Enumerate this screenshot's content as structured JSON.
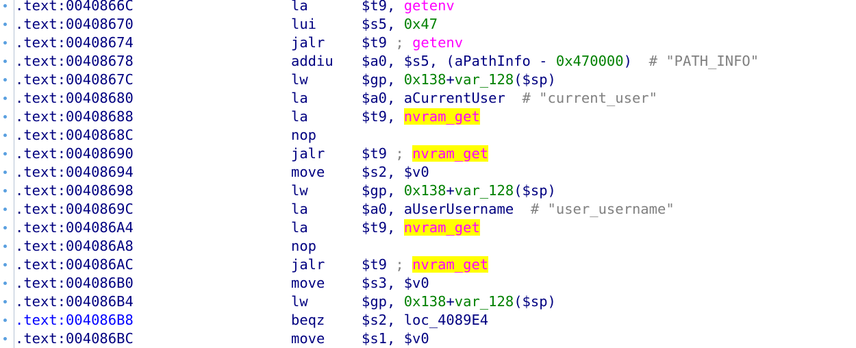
{
  "colors": {
    "background": "#ffffff",
    "address": "#000080",
    "active_address": "#0000ff",
    "mnemonic": "#000080",
    "register": "#000080",
    "import_name": "#ff00ff",
    "number": "#008000",
    "comment": "#808080",
    "highlight": "#ffff00",
    "gutter_dot": "#5aa0e0"
  },
  "listing": {
    "rows": [
      {
        "address": ".text:0040866C",
        "mnemonic": "la",
        "active": false,
        "operands": [
          {
            "t": "$t9, ",
            "c": "reg"
          },
          {
            "t": "getenv",
            "c": "imp"
          }
        ]
      },
      {
        "address": ".text:00408670",
        "mnemonic": "lui",
        "active": false,
        "operands": [
          {
            "t": "$s5, ",
            "c": "reg"
          },
          {
            "t": "0x47",
            "c": "num"
          }
        ]
      },
      {
        "address": ".text:00408674",
        "mnemonic": "jalr",
        "active": false,
        "operands": [
          {
            "t": "$t9 ",
            "c": "reg"
          },
          {
            "t": "; ",
            "c": "cmt"
          },
          {
            "t": "getenv",
            "c": "imp"
          }
        ]
      },
      {
        "address": ".text:00408678",
        "mnemonic": "addiu",
        "active": false,
        "operands": [
          {
            "t": "$a0, $s5, (aPathInfo - ",
            "c": "reg"
          },
          {
            "t": "0x470000",
            "c": "num"
          },
          {
            "t": ")  ",
            "c": "reg"
          },
          {
            "t": "# \"PATH_INFO\"",
            "c": "cmt"
          }
        ]
      },
      {
        "address": ".text:0040867C",
        "mnemonic": "lw",
        "active": false,
        "operands": [
          {
            "t": "$gp, ",
            "c": "reg"
          },
          {
            "t": "0x138",
            "c": "num"
          },
          {
            "t": "+",
            "c": "reg"
          },
          {
            "t": "var_128",
            "c": "data"
          },
          {
            "t": "($sp)",
            "c": "reg"
          }
        ]
      },
      {
        "address": ".text:00408680",
        "mnemonic": "la",
        "active": false,
        "operands": [
          {
            "t": "$a0, aCurrentUser  ",
            "c": "reg"
          },
          {
            "t": "# \"current_user\"",
            "c": "cmt"
          }
        ]
      },
      {
        "address": ".text:00408688",
        "mnemonic": "la",
        "active": false,
        "operands": [
          {
            "t": "$t9, ",
            "c": "reg"
          },
          {
            "t": "nvram_get",
            "c": "hl"
          }
        ]
      },
      {
        "address": ".text:0040868C",
        "mnemonic": "nop",
        "active": false,
        "operands": []
      },
      {
        "address": ".text:00408690",
        "mnemonic": "jalr",
        "active": false,
        "operands": [
          {
            "t": "$t9 ",
            "c": "reg"
          },
          {
            "t": "; ",
            "c": "cmt"
          },
          {
            "t": "nvram_get",
            "c": "hl"
          }
        ]
      },
      {
        "address": ".text:00408694",
        "mnemonic": "move",
        "active": false,
        "operands": [
          {
            "t": "$s2, $v0",
            "c": "reg"
          }
        ]
      },
      {
        "address": ".text:00408698",
        "mnemonic": "lw",
        "active": false,
        "operands": [
          {
            "t": "$gp, ",
            "c": "reg"
          },
          {
            "t": "0x138",
            "c": "num"
          },
          {
            "t": "+",
            "c": "reg"
          },
          {
            "t": "var_128",
            "c": "data"
          },
          {
            "t": "($sp)",
            "c": "reg"
          }
        ]
      },
      {
        "address": ".text:0040869C",
        "mnemonic": "la",
        "active": false,
        "operands": [
          {
            "t": "$a0, aUserUsername  ",
            "c": "reg"
          },
          {
            "t": "# \"user_username\"",
            "c": "cmt"
          }
        ]
      },
      {
        "address": ".text:004086A4",
        "mnemonic": "la",
        "active": false,
        "operands": [
          {
            "t": "$t9, ",
            "c": "reg"
          },
          {
            "t": "nvram_get",
            "c": "hl"
          }
        ]
      },
      {
        "address": ".text:004086A8",
        "mnemonic": "nop",
        "active": false,
        "operands": []
      },
      {
        "address": ".text:004086AC",
        "mnemonic": "jalr",
        "active": false,
        "operands": [
          {
            "t": "$t9 ",
            "c": "reg"
          },
          {
            "t": "; ",
            "c": "cmt"
          },
          {
            "t": "nvram_get",
            "c": "hl"
          }
        ]
      },
      {
        "address": ".text:004086B0",
        "mnemonic": "move",
        "active": false,
        "operands": [
          {
            "t": "$s3, $v0",
            "c": "reg"
          }
        ]
      },
      {
        "address": ".text:004086B4",
        "mnemonic": "lw",
        "active": false,
        "operands": [
          {
            "t": "$gp, ",
            "c": "reg"
          },
          {
            "t": "0x138",
            "c": "num"
          },
          {
            "t": "+",
            "c": "reg"
          },
          {
            "t": "var_128",
            "c": "data"
          },
          {
            "t": "($sp)",
            "c": "reg"
          }
        ]
      },
      {
        "address": ".text:004086B8",
        "mnemonic": "beqz",
        "active": true,
        "operands": [
          {
            "t": "$s2, loc_4089E4",
            "c": "lbl"
          }
        ]
      },
      {
        "address": ".text:004086BC",
        "mnemonic": "move",
        "active": false,
        "operands": [
          {
            "t": "$s1, $v0",
            "c": "reg"
          }
        ]
      }
    ]
  }
}
